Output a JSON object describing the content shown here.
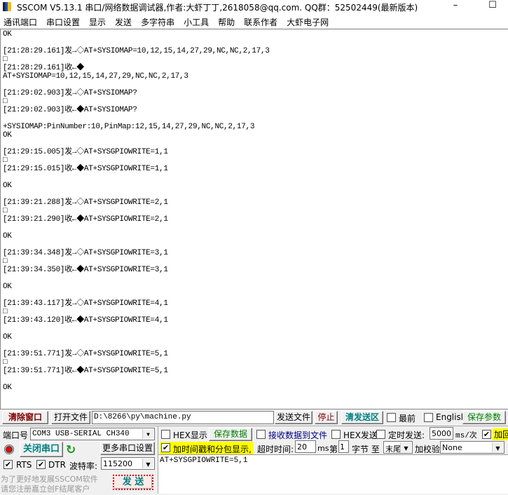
{
  "title": "SSCOM V5.13.1 串口/网络数据调试器,作者:大虾丁丁,2618058@qq.com. QQ群：52502449(最新版本)",
  "menu": [
    "通讯端口",
    "串口设置",
    "显示",
    "发送",
    "多字符串",
    "小工具",
    "帮助",
    "联系作者",
    "大虾电子网"
  ],
  "log": [
    "OK",
    "",
    "[21:28:29.161]发→◇AT+SYSIOMAP=10,12,15,14,27,29,NC,NC,2,17,3",
    "□",
    "[21:28:29.161]收←◆",
    "AT+SYSIOMAP=10,12,15,14,27,29,NC,NC,2,17,3",
    "",
    "[21:29:02.903]发→◇AT+SYSIOMAP?",
    "□",
    "[21:29:02.903]收←◆AT+SYSIOMAP?",
    "",
    "+SYSIOMAP:PinNumber:10,PinMap:12,15,14,27,29,NC,NC,2,17,3",
    "OK",
    "",
    "[21:29:15.005]发→◇AT+SYSGPIOWRITE=1,1",
    "□",
    "[21:29:15.015]收←◆AT+SYSGPIOWRITE=1,1",
    "",
    "OK",
    "",
    "[21:39:21.288]发→◇AT+SYSGPIOWRITE=2,1",
    "□",
    "[21:39:21.290]收←◆AT+SYSGPIOWRITE=2,1",
    "",
    "OK",
    "",
    "[21:39:34.348]发→◇AT+SYSGPIOWRITE=3,1",
    "□",
    "[21:39:34.350]收←◆AT+SYSGPIOWRITE=3,1",
    "",
    "OK",
    "",
    "[21:39:43.117]发→◇AT+SYSGPIOWRITE=4,1",
    "□",
    "[21:39:43.120]收←◆AT+SYSGPIOWRITE=4,1",
    "",
    "OK",
    "",
    "[21:39:51.771]发→◇AT+SYSGPIOWRITE=5,1",
    "□",
    "[21:39:51.771]收←◆AT+SYSGPIOWRITE=5,1",
    "",
    "OK"
  ],
  "toolbar": {
    "clear": "清除窗口",
    "open_file": "打开文件",
    "file_path": "D:\\8266\\py\\machine.py",
    "send_file": "发送文件",
    "stop": "停止",
    "clear_send": "清发送区",
    "topmost": "最前",
    "english": "English",
    "save_params": "保存参数"
  },
  "port": {
    "label": "端口号",
    "value": "COM3 USB-SERIAL CH340",
    "close": "关闭串口",
    "more": "更多串口设置",
    "rts": "RTS",
    "dtr": "DTR",
    "baud_label": "波特率:",
    "baud": "115200",
    "promo1": "为了更好地发展SSCOM软件",
    "promo2": "请您注册嘉立创F结尾客户",
    "send": "发  送"
  },
  "opts": {
    "hex_show": "HEX显示",
    "save_data": "保存数据",
    "recv_to_file": "接收数据到文件",
    "hex_send": "HEX发送",
    "timed_send": "定时发送:",
    "interval": "5000",
    "interval_unit": "ms/次",
    "add_return": "加回",
    "timestamp": "加时间戳和分包显示,",
    "timeout_label": "超时时间:",
    "timeout": "20",
    "timeout_unit": "ms",
    "byte_prefix": "第",
    "byte_from": "1",
    "byte_suffix": "字节 至",
    "byte_to": "末尾",
    "checksum_label": "加校验",
    "checksum": "None"
  },
  "send_text": "AT+SYSGPIOWRITE=5,1",
  "colors": {
    "clear": "#800000",
    "close": "#008080",
    "save": "#008000",
    "recv_file": "#000080",
    "highlight": "#ffff00"
  }
}
